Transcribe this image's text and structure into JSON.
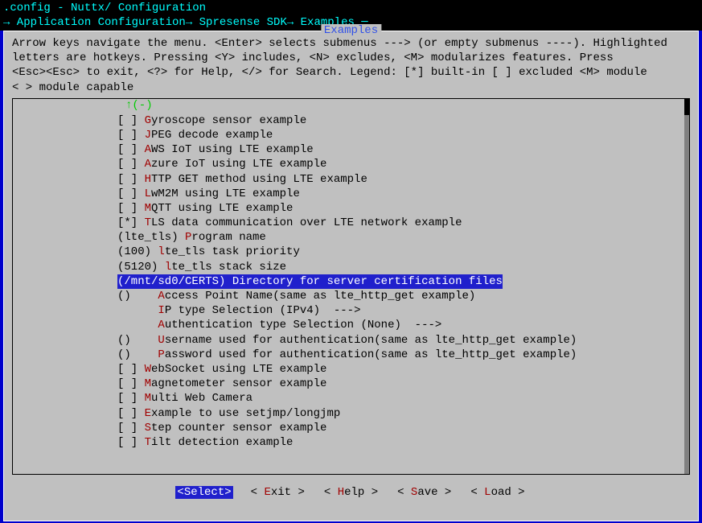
{
  "title": ".config - Nuttx/ Configuration",
  "breadcrumb": "→ Application Configuration→ Spresense SDK→ Examples ─",
  "window_label": "Examples",
  "help_lines": [
    "Arrow keys navigate the menu.  <Enter> selects submenus ---> (or empty submenus ----).  Highlighted",
    "letters are hotkeys.  Pressing <Y> includes, <N> excludes, <M> modularizes features.  Press",
    "<Esc><Esc> to exit, <?> for Help, </> for Search.  Legend: [*] built-in  [ ] excluded  <M> module",
    "< > module capable"
  ],
  "scroll_marker": "↑(-)",
  "items": [
    {
      "prefix": "[ ] ",
      "hotkey": "G",
      "text": "yroscope sensor example",
      "selected": false
    },
    {
      "prefix": "[ ] ",
      "hotkey": "J",
      "text": "PEG decode example",
      "selected": false
    },
    {
      "prefix": "[ ] ",
      "hotkey": "A",
      "text": "WS IoT using LTE example",
      "selected": false
    },
    {
      "prefix": "[ ] ",
      "hotkey": "A",
      "text": "zure IoT using LTE example",
      "selected": false
    },
    {
      "prefix": "[ ] ",
      "hotkey": "H",
      "text": "TTP GET method using LTE example",
      "selected": false
    },
    {
      "prefix": "[ ] ",
      "hotkey": "L",
      "text": "wM2M using LTE example",
      "selected": false
    },
    {
      "prefix": "[ ] ",
      "hotkey": "M",
      "text": "QTT using LTE example",
      "selected": false
    },
    {
      "prefix": "[*] ",
      "hotkey": "T",
      "text": "LS data communication over LTE network example",
      "selected": false
    },
    {
      "prefix": "(lte_tls) ",
      "hotkey": "P",
      "text": "rogram name",
      "selected": false
    },
    {
      "prefix": "(100) ",
      "hotkey": "l",
      "text": "te_tls task priority",
      "selected": false
    },
    {
      "prefix": "(5120) ",
      "hotkey": "l",
      "text": "te_tls stack size",
      "selected": false
    },
    {
      "prefix": "(/mnt/sd0/CERTS) ",
      "hotkey": "D",
      "text": "irectory for server certification files",
      "selected": true
    },
    {
      "prefix": "()    ",
      "hotkey": "A",
      "text": "ccess Point Name(same as lte_http_get example)",
      "selected": false
    },
    {
      "prefix": "      ",
      "hotkey": "I",
      "text": "P type Selection (IPv4)  --->",
      "selected": false
    },
    {
      "prefix": "      ",
      "hotkey": "A",
      "text": "uthentication type Selection (None)  --->",
      "selected": false
    },
    {
      "prefix": "()    ",
      "hotkey": "U",
      "text": "sername used for authentication(same as lte_http_get example)",
      "selected": false
    },
    {
      "prefix": "()    ",
      "hotkey": "P",
      "text": "assword used for authentication(same as lte_http_get example)",
      "selected": false
    },
    {
      "prefix": "[ ] ",
      "hotkey": "W",
      "text": "ebSocket using LTE example",
      "selected": false
    },
    {
      "prefix": "[ ] ",
      "hotkey": "M",
      "text": "agnetometer sensor example",
      "selected": false
    },
    {
      "prefix": "[ ] ",
      "hotkey": "M",
      "text": "ulti Web Camera",
      "selected": false
    },
    {
      "prefix": "[ ] ",
      "hotkey": "E",
      "text": "xample to use setjmp/longjmp",
      "selected": false
    },
    {
      "prefix": "[ ] ",
      "hotkey": "S",
      "text": "tep counter sensor example",
      "selected": false
    },
    {
      "prefix": "[ ] ",
      "hotkey": "T",
      "text": "ilt detection example",
      "selected": false
    }
  ],
  "buttons": [
    {
      "pre": "<",
      "hotkey": "S",
      "post": "elect>",
      "active": true
    },
    {
      "pre": "< ",
      "hotkey": "E",
      "post": "xit >",
      "active": false
    },
    {
      "pre": "< ",
      "hotkey": "H",
      "post": "elp >",
      "active": false
    },
    {
      "pre": "< ",
      "hotkey": "S",
      "post": "ave >",
      "active": false
    },
    {
      "pre": "< ",
      "hotkey": "L",
      "post": "oad >",
      "active": false
    }
  ]
}
